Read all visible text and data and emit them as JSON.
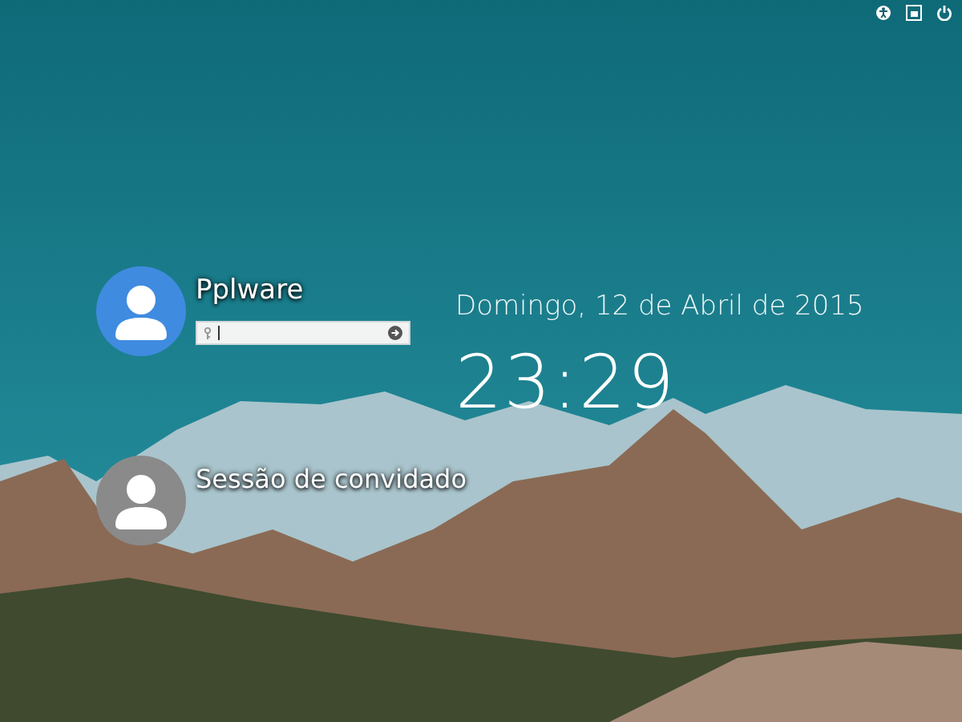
{
  "users": [
    {
      "name": "Pplware",
      "selected": true
    },
    {
      "name": "Sessão de convidado",
      "selected": false
    }
  ],
  "clock": {
    "date": "Domingo, 12 de Abril de 2015",
    "time": "23:29"
  }
}
